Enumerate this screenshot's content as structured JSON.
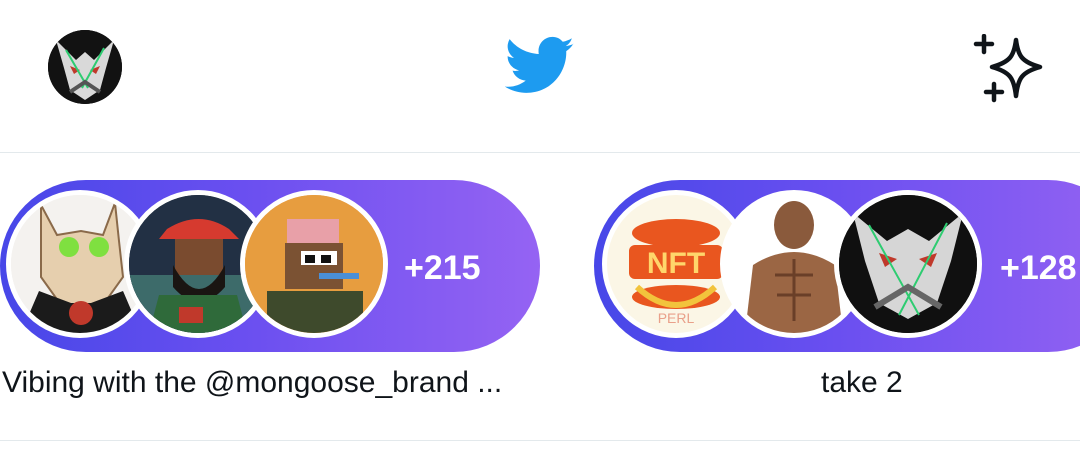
{
  "header": {
    "profile_icon": "profile-avatar-icon",
    "logo_icon": "twitter-bird-icon",
    "sparkle_icon": "sparkle-icon",
    "brand_color": "#1d9bf0"
  },
  "spaces": [
    {
      "count": "+215",
      "caption": "Vibing with the @mongoose_brand ..."
    },
    {
      "count": "+128",
      "caption": "take 2"
    }
  ],
  "colors": {
    "pill_start": "#4747e8",
    "pill_end": "#9563f3",
    "divider": "#e3e9ec"
  }
}
